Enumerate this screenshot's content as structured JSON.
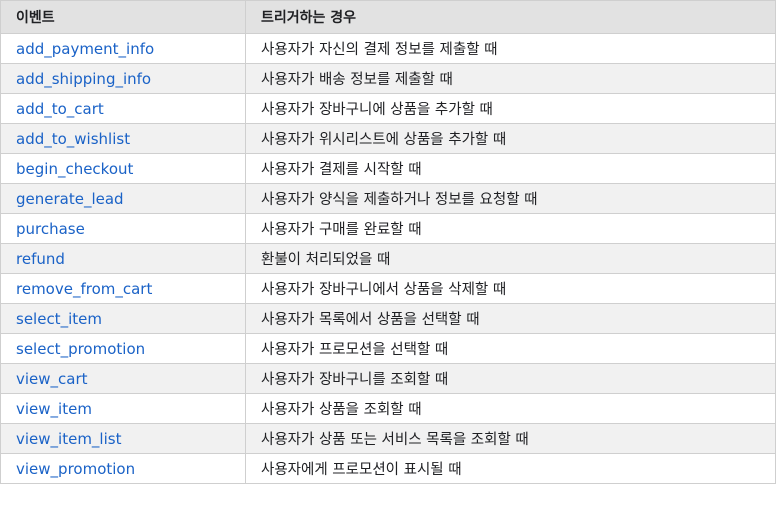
{
  "table": {
    "headers": [
      "이벤트",
      "트리거하는 경우"
    ],
    "rows": [
      {
        "event": "add_payment_info",
        "trigger": "사용자가 자신의 결제 정보를 제출할 때"
      },
      {
        "event": "add_shipping_info",
        "trigger": "사용자가 배송 정보를 제출할 때"
      },
      {
        "event": "add_to_cart",
        "trigger": "사용자가 장바구니에 상품을 추가할 때"
      },
      {
        "event": "add_to_wishlist",
        "trigger": "사용자가 위시리스트에 상품을 추가할 때"
      },
      {
        "event": "begin_checkout",
        "trigger": "사용자가 결제를 시작할 때"
      },
      {
        "event": "generate_lead",
        "trigger": "사용자가 양식을 제출하거나 정보를 요청할 때"
      },
      {
        "event": "purchase",
        "trigger": "사용자가 구매를 완료할 때"
      },
      {
        "event": "refund",
        "trigger": "환불이 처리되었을 때"
      },
      {
        "event": "remove_from_cart",
        "trigger": "사용자가 장바구니에서 상품을 삭제할 때"
      },
      {
        "event": "select_item",
        "trigger": "사용자가 목록에서 상품을 선택할 때"
      },
      {
        "event": "select_promotion",
        "trigger": "사용자가 프로모션을 선택할 때"
      },
      {
        "event": "view_cart",
        "trigger": "사용자가 장바구니를 조회할 때"
      },
      {
        "event": "view_item",
        "trigger": "사용자가 상품을 조회할 때"
      },
      {
        "event": "view_item_list",
        "trigger": "사용자가 상품 또는 서비스 목록을 조회할 때"
      },
      {
        "event": "view_promotion",
        "trigger": "사용자에게 프로모션이 표시될 때"
      }
    ]
  },
  "colors": {
    "link": "#1a62c7",
    "header_bg": "#e2e2e2",
    "stripe_bg": "#f1f1f1",
    "border": "#cfcfcf"
  }
}
